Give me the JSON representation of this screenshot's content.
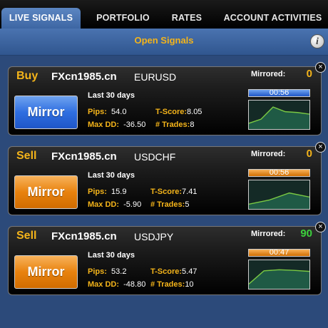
{
  "tabs": [
    {
      "label": "LIVE SIGNALS"
    },
    {
      "label": "PORTFOLIO"
    },
    {
      "label": "RATES"
    },
    {
      "label": "ACCOUNT ACTIVITIES"
    }
  ],
  "header": {
    "title": "Open Signals",
    "info_icon": "i"
  },
  "common": {
    "mirrored_label": "Mirrored:",
    "mirror_button": "Mirror",
    "period": "Last 30 days",
    "pips_label": "Pips:",
    "tscore_label": "T-Score:",
    "maxdd_label": "Max DD:",
    "trades_label": "# Trades:",
    "close_glyph": "×"
  },
  "colors": {
    "accent": "#f4b41a",
    "blue_button": "#2f6ee0",
    "orange_button": "#e8820e",
    "mirrored_zero": "#f4b41a",
    "mirrored_positive": "#3cd13c",
    "chart_line": "#7ac943",
    "chart_fill": "#1f5a45"
  },
  "signals": [
    {
      "side": "Buy",
      "provider": "FXcn1985.cn",
      "pair": "EURUSD",
      "mirrored": "0",
      "mirrored_color": "#f4b41a",
      "pips": "54.0",
      "tscore": "8.05",
      "maxdd": "-36.50",
      "trades": "8",
      "timer": "00:56",
      "timer_color": "blue",
      "timer_fraction": 1.0,
      "trend": [
        0.15,
        0.35,
        0.95,
        0.72,
        0.68,
        0.6
      ]
    },
    {
      "side": "Sell",
      "provider": "FXcn1985.cn",
      "pair": "USDCHF",
      "mirrored": "0",
      "mirrored_color": "#f4b41a",
      "pips": "15.9",
      "tscore": "7.41",
      "maxdd": "-5.90",
      "trades": "5",
      "timer": "00:56",
      "timer_color": "orange",
      "timer_fraction": 1.0,
      "trend": [
        0.1,
        0.3,
        0.65,
        0.45
      ]
    },
    {
      "side": "Sell",
      "provider": "FXcn1985.cn",
      "pair": "USDJPY",
      "mirrored": "90",
      "mirrored_color": "#3cd13c",
      "pips": "53.2",
      "tscore": "5.47",
      "maxdd": "-48.80",
      "trades": "10",
      "timer": "00:47",
      "timer_color": "orange",
      "timer_fraction": 1.0,
      "trend": [
        0.1,
        0.75,
        0.8,
        0.77,
        0.72
      ]
    }
  ]
}
